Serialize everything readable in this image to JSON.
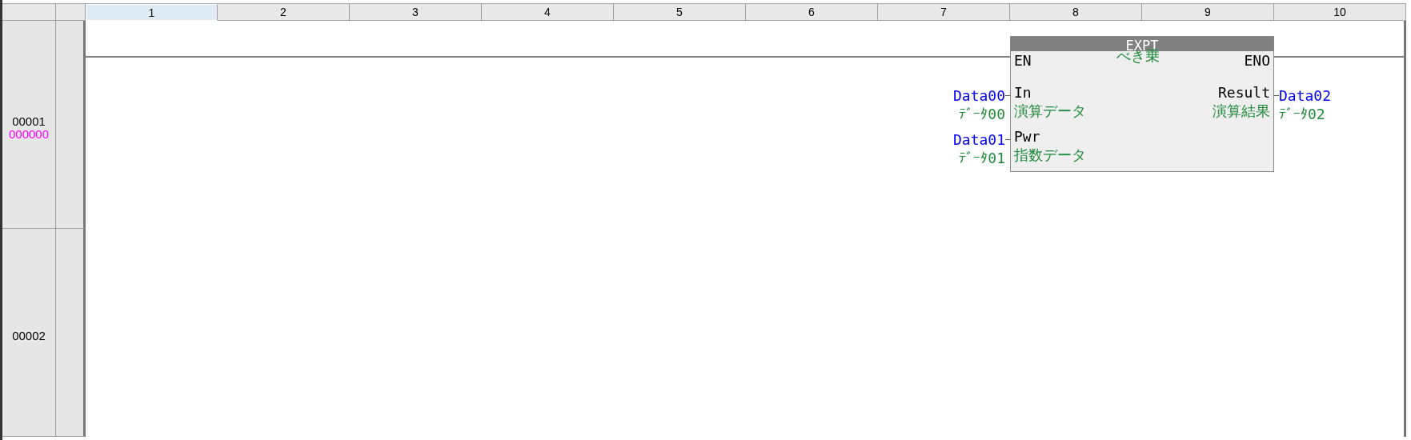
{
  "columns": [
    {
      "label": "1",
      "selected": true
    },
    {
      "label": "2",
      "selected": false
    },
    {
      "label": "3",
      "selected": false
    },
    {
      "label": "4",
      "selected": false
    },
    {
      "label": "5",
      "selected": false
    },
    {
      "label": "6",
      "selected": false
    },
    {
      "label": "7",
      "selected": false
    },
    {
      "label": "8",
      "selected": false
    },
    {
      "label": "9",
      "selected": false
    },
    {
      "label": "10",
      "selected": false
    }
  ],
  "rows": [
    {
      "number": "00001",
      "step": "000000"
    },
    {
      "number": "00002"
    }
  ],
  "function_block": {
    "name": "EXPT",
    "comment": "べき乗",
    "en": "EN",
    "eno": "ENO",
    "inputs": [
      {
        "pin": "In",
        "comment": "演算データ",
        "variable": "Data00",
        "variable_comment": "ﾃﾞｰﾀ00"
      },
      {
        "pin": "Pwr",
        "comment": "指数データ",
        "variable": "Data01",
        "variable_comment": "ﾃﾞｰﾀ01"
      }
    ],
    "outputs": [
      {
        "pin": "Result",
        "comment": "演算結果",
        "variable": "Data02",
        "variable_comment": "ﾃﾞｰﾀ02"
      }
    ]
  }
}
